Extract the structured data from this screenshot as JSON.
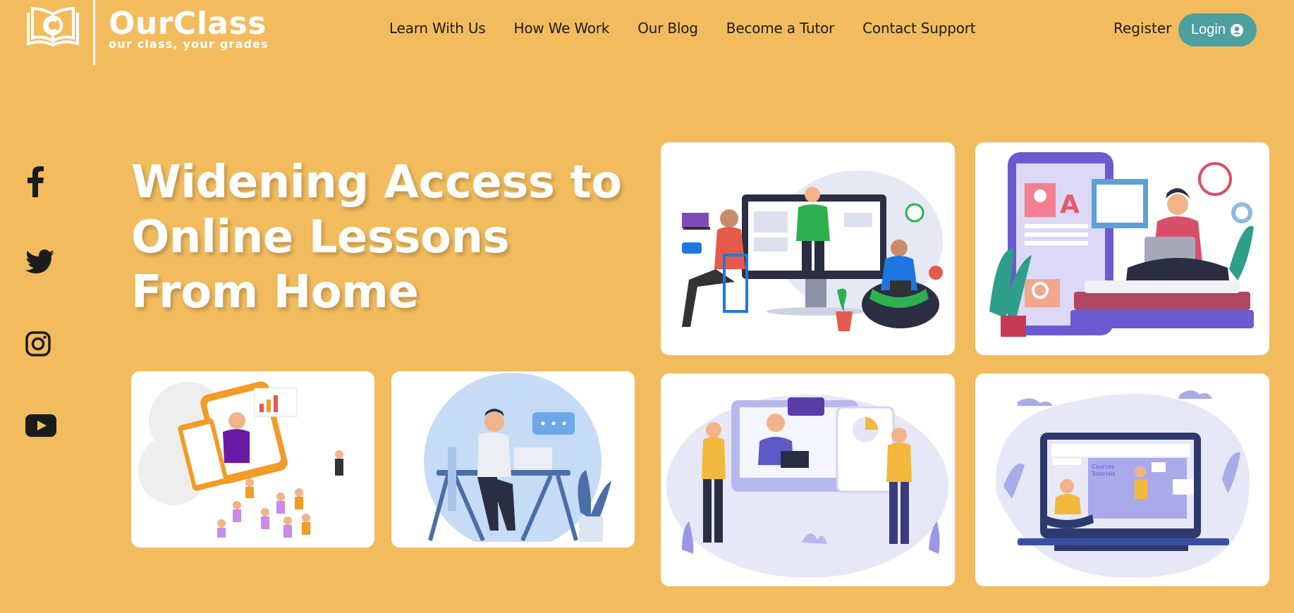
{
  "brand": {
    "name": "OurClass",
    "tagline": "our class, your grades",
    "logo_icon": "book-logo-icon"
  },
  "nav": {
    "items": [
      "Learn With Us",
      "How We Work",
      "Our Blog",
      "Become a Tutor",
      "Contact Support"
    ]
  },
  "auth": {
    "register_label": "Register",
    "login_label": "Login",
    "login_icon": "user-circle-icon",
    "login_color": "#4D9FA0"
  },
  "social": [
    "facebook-icon",
    "twitter-icon",
    "instagram-icon",
    "youtube-icon"
  ],
  "hero": {
    "title": "Widening Access to Online Lessons From Home"
  },
  "colors": {
    "background": "#F2BC5E",
    "text": "#1B1B1B",
    "card": "#FFFFFF"
  },
  "illustrations": [
    "live-class-illustration",
    "reading-tablet-illustration",
    "video-lesson-group-illustration",
    "desk-chat-illustration",
    "video-conference-illustration",
    "laptop-tutorial-illustration"
  ]
}
